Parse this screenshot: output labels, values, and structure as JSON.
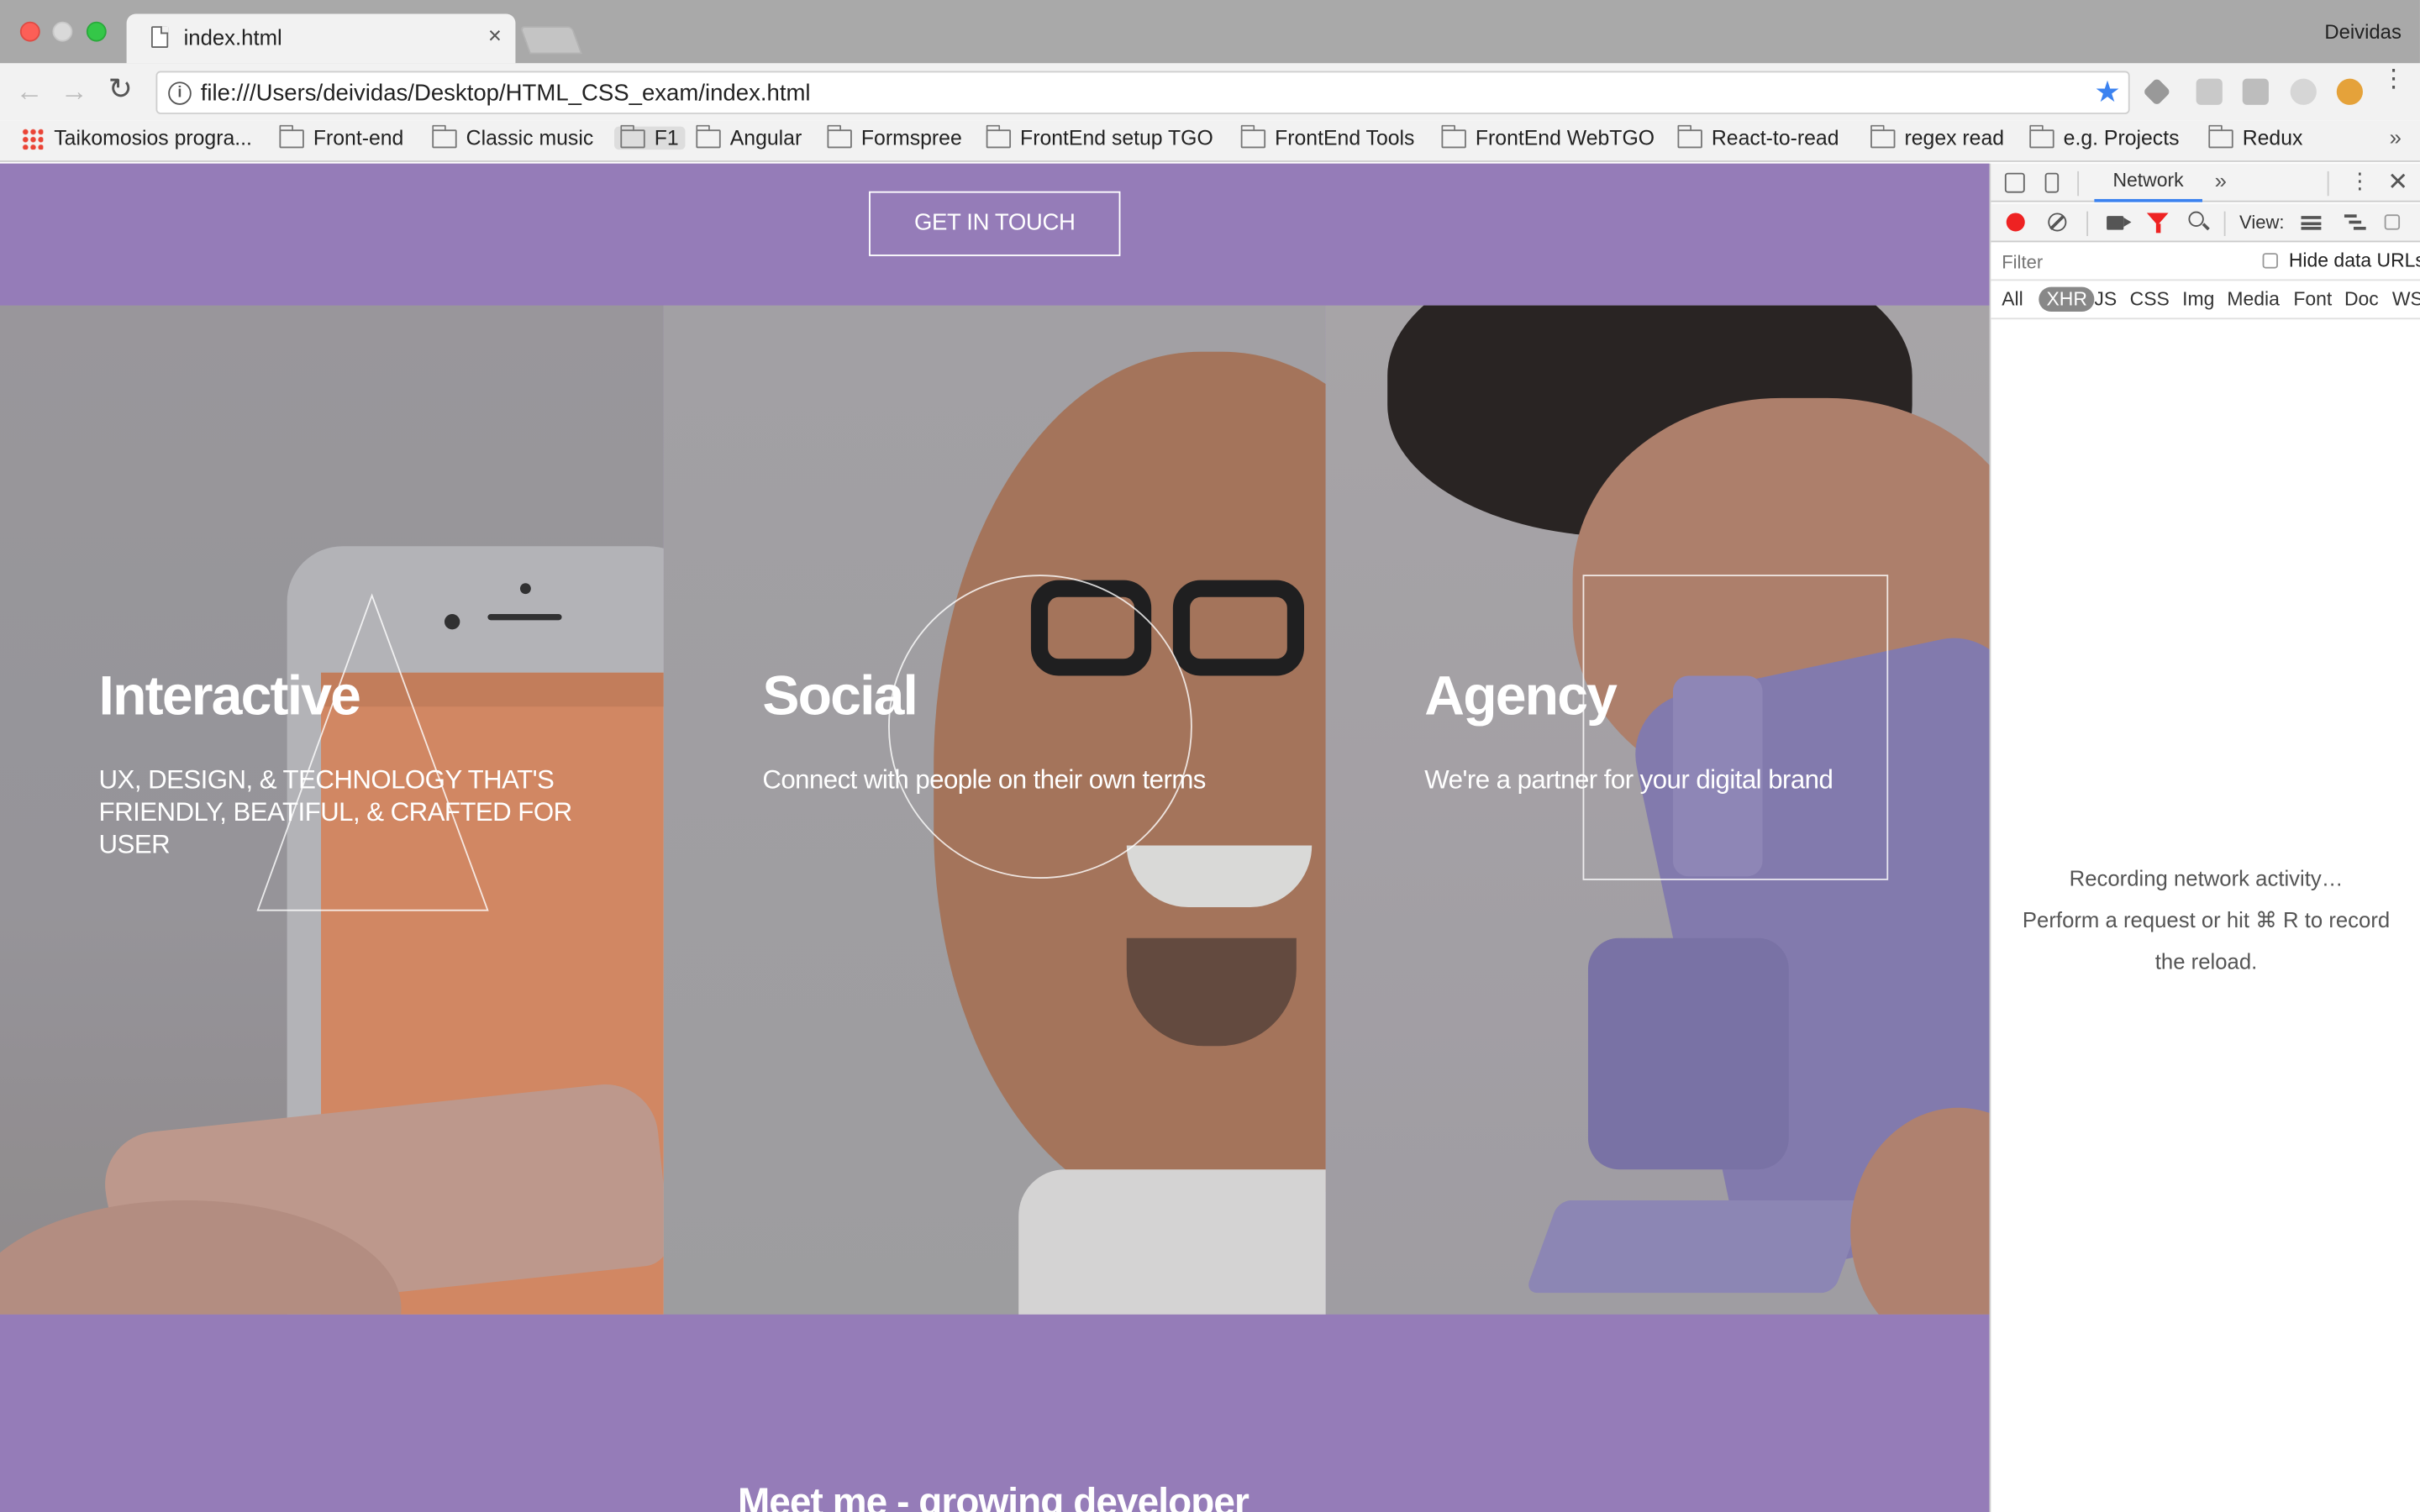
{
  "window": {
    "tab_title": "index.html",
    "tab_close": "×",
    "profile_name": "Deividas"
  },
  "toolbar": {
    "back": "←",
    "forward": "→",
    "reload": "↻",
    "url": "file:///Users/deividas/Desktop/HTML_CSS_exam/index.html",
    "info": "i",
    "star": "★",
    "menu": "⋮"
  },
  "bookmarks": {
    "items": [
      "Taikomosios progra...",
      "Front-end",
      "Classic music",
      "F1",
      "Angular",
      "Formspree",
      "FrontEnd setup TGO",
      "FrontEnd Tools",
      "FrontEnd WebTGO",
      "React-to-read",
      "regex read",
      "e.g. Projects",
      "Redux"
    ],
    "more": "»"
  },
  "page": {
    "cta_label": "GET IN TOUCH",
    "panels": [
      {
        "title": "Interactive",
        "text": "UX, DESIGN, & TECHNOLOGY THAT'S FRIENDLY, BEATIFUL, & CRAFTED FOR USER"
      },
      {
        "title": "Social",
        "text": "Connect with people on their own terms"
      },
      {
        "title": "Agency",
        "text": "We're a partner for your digital brand"
      }
    ],
    "section_title": "Meet me - growing developer",
    "colors": {
      "accent": "#957cb8"
    }
  },
  "devtools": {
    "active_tab": "Network",
    "more_tabs": "»",
    "kebab": "⋮",
    "close": "✕",
    "view_label": "View:",
    "filter_placeholder": "Filter",
    "hide_data_urls": "Hide data URLs",
    "types": [
      "All",
      "XHR",
      "JS",
      "CSS",
      "Img",
      "Media",
      "Font",
      "Doc",
      "WS"
    ],
    "empty_line1": "Recording network activity…",
    "empty_line2": "Perform a request or hit ⌘ R to record",
    "empty_line3": "the reload."
  }
}
